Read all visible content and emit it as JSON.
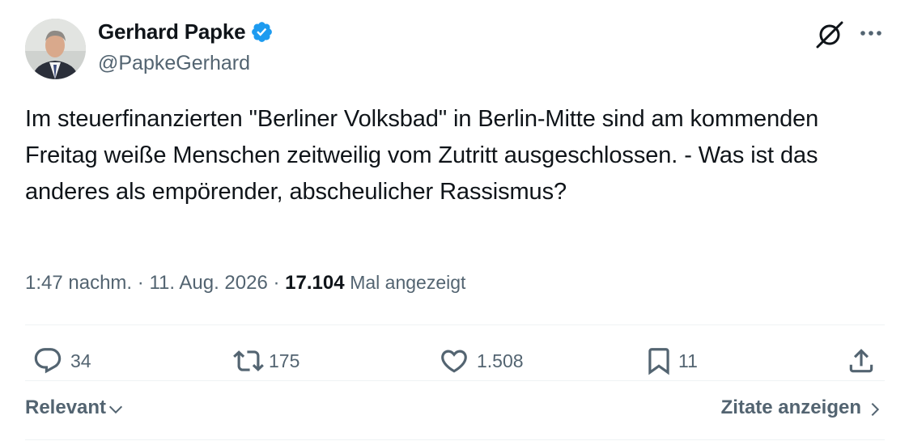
{
  "author": {
    "display_name": "Gerhard Papke",
    "handle": "@PapkeGerhard"
  },
  "tweet": {
    "text": "Im steuerfinanzierten \"Berliner Volksbad\" in Berlin-Mitte sind am kommenden Freitag weiße Menschen zeitweilig vom Zutritt ausgeschlossen. - Was ist das anderes als empörender, abscheulicher Rassismus?",
    "time": "1:47 nachm.",
    "separator": "·",
    "date": "11. Aug. 2026",
    "views_count": "17.104",
    "views_label": "Mal angezeigt"
  },
  "actions": {
    "replies": "34",
    "reposts": "175",
    "likes": "1.508",
    "bookmarks": "11"
  },
  "footer": {
    "sort_label": "Relevant",
    "quotes_label": "Zitate anzeigen"
  },
  "colors": {
    "verified": "#1d9bf0",
    "secondary_text": "#536471",
    "primary_text": "#0f1419"
  },
  "icons": [
    "verified-badge-icon",
    "grok-icon",
    "more-icon",
    "reply-icon",
    "repost-icon",
    "like-icon",
    "bookmark-icon",
    "share-icon",
    "chevron-down-icon",
    "chevron-right-icon"
  ]
}
